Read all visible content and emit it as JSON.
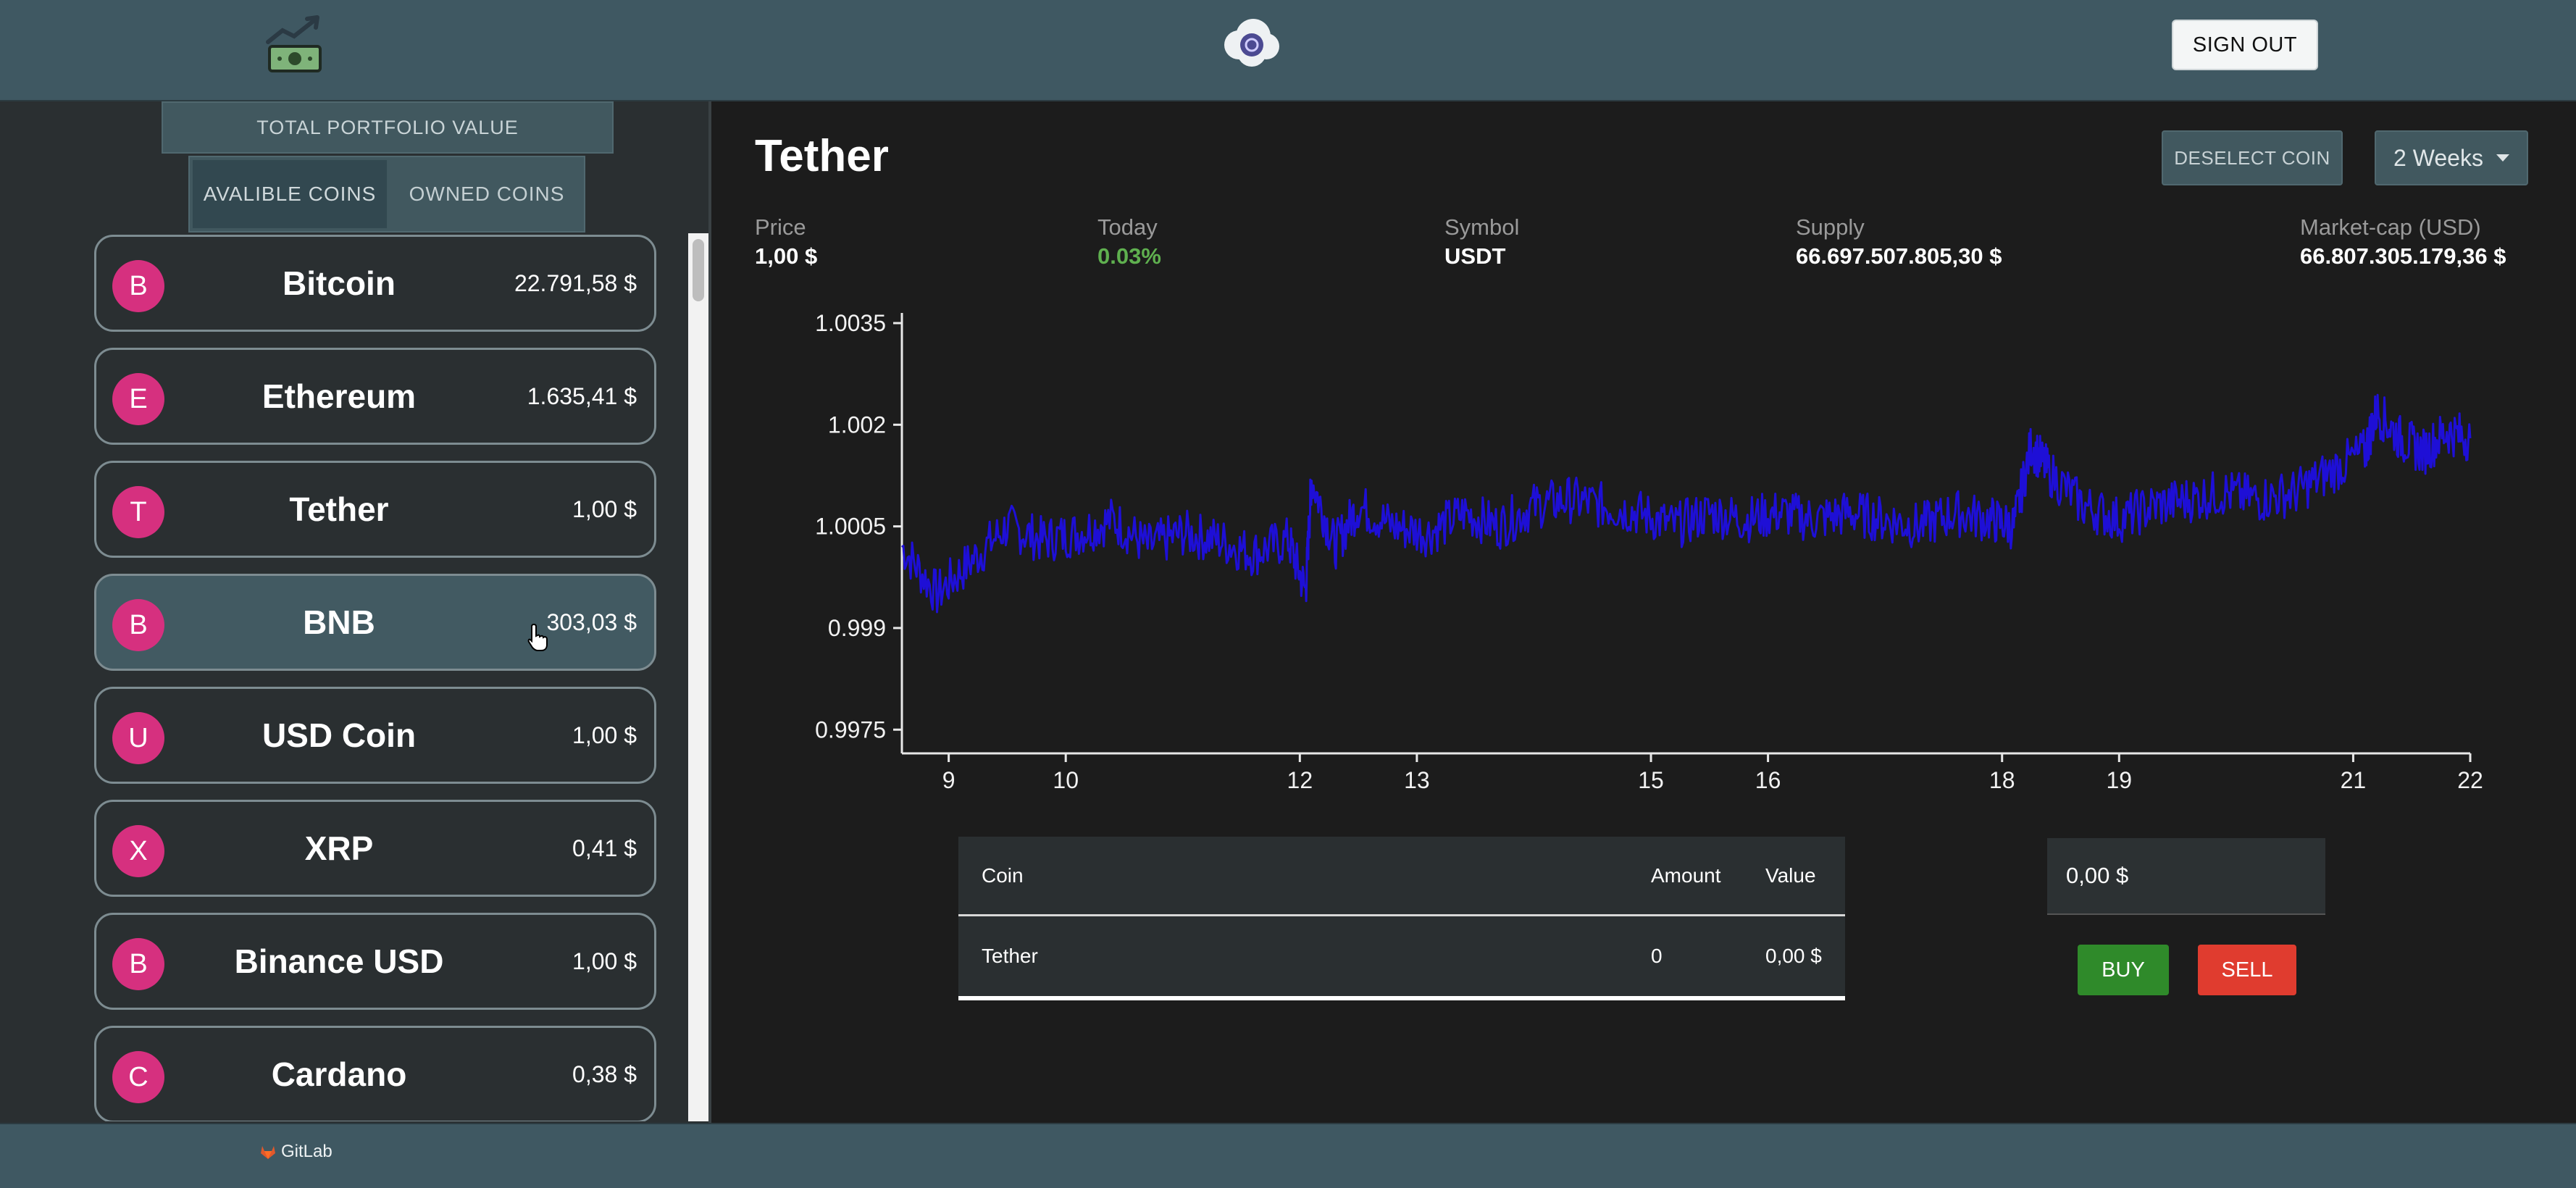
{
  "header": {
    "signout_label": "SIGN OUT"
  },
  "sidebar": {
    "portfolio_label": "TOTAL PORTFOLIO VALUE",
    "tabs": [
      {
        "label": "AVALIBLE COINS",
        "active": true
      },
      {
        "label": "OWNED COINS",
        "active": false
      }
    ],
    "coins": [
      {
        "avatar": "B",
        "name": "Bitcoin",
        "price": "22.791,58 $"
      },
      {
        "avatar": "E",
        "name": "Ethereum",
        "price": "1.635,41 $"
      },
      {
        "avatar": "T",
        "name": "Tether",
        "price": "1,00 $"
      },
      {
        "avatar": "B",
        "name": "BNB",
        "price": "303,03 $",
        "hovered": true
      },
      {
        "avatar": "U",
        "name": "USD Coin",
        "price": "1,00 $"
      },
      {
        "avatar": "X",
        "name": "XRP",
        "price": "0,41 $"
      },
      {
        "avatar": "B",
        "name": "Binance USD",
        "price": "1,00 $"
      },
      {
        "avatar": "C",
        "name": "Cardano",
        "price": "0,38 $"
      }
    ]
  },
  "main": {
    "title": "Tether",
    "deselect_label": "DESELECT COIN",
    "range_label": "2 Weeks",
    "stats": {
      "price_label": "Price",
      "price_value": "1,00 $",
      "today_label": "Today",
      "today_value": "0.03%",
      "symbol_label": "Symbol",
      "symbol_value": "USDT",
      "supply_label": "Supply",
      "supply_value": "66.697.507.805,30 $",
      "marketcap_label": "Market-cap (USD)",
      "marketcap_value": "66.807.305.179,36 $"
    }
  },
  "chart_data": {
    "type": "line",
    "title": "",
    "xlabel": "",
    "ylabel": "",
    "x_ticks": [
      "9",
      "10",
      "12",
      "13",
      "15",
      "16",
      "18",
      "19",
      "21",
      "22"
    ],
    "y_ticks": [
      "0.9975",
      "0.999",
      "1.0005",
      "1.002",
      "1.0035"
    ],
    "ylim": [
      0.99715,
      1.00365
    ],
    "xlim": [
      8.6,
      22
    ],
    "line_color": "#1e0fd6",
    "series": [
      {
        "points": [
          [
            8.6,
            1.0002
          ],
          [
            8.9,
            0.9995
          ],
          [
            9.2,
            1.0
          ],
          [
            9.5,
            1.0005
          ],
          [
            9.8,
            1.0003
          ],
          [
            10.1,
            1.0004
          ],
          [
            10.4,
            1.0006
          ],
          [
            10.7,
            1.0002
          ],
          [
            11.0,
            1.0004
          ],
          [
            11.3,
            1.0003
          ],
          [
            11.6,
            1.0001
          ],
          [
            11.9,
            1.0003
          ],
          [
            12.05,
            0.99955
          ],
          [
            12.1,
            1.0012
          ],
          [
            12.3,
            1.0002
          ],
          [
            12.5,
            1.0008
          ],
          [
            12.8,
            1.0005
          ],
          [
            13.1,
            1.0004
          ],
          [
            13.4,
            1.0007
          ],
          [
            13.7,
            1.0005
          ],
          [
            14.0,
            1.0008
          ],
          [
            14.3,
            1.0009
          ],
          [
            14.6,
            1.0008
          ],
          [
            14.9,
            1.0007
          ],
          [
            15.2,
            1.0005
          ],
          [
            15.5,
            1.0007
          ],
          [
            15.8,
            1.0006
          ],
          [
            16.1,
            1.0007
          ],
          [
            16.4,
            1.0006
          ],
          [
            16.7,
            1.0007
          ],
          [
            17.0,
            1.0006
          ],
          [
            17.3,
            1.0005
          ],
          [
            17.6,
            1.0007
          ],
          [
            17.9,
            1.0006
          ],
          [
            18.1,
            1.0005
          ],
          [
            18.25,
            1.0017
          ],
          [
            18.4,
            1.0013
          ],
          [
            18.7,
            1.0008
          ],
          [
            19.0,
            1.0006
          ],
          [
            19.3,
            1.0008
          ],
          [
            19.6,
            1.0009
          ],
          [
            19.9,
            1.001
          ],
          [
            20.2,
            1.0009
          ],
          [
            20.5,
            1.001
          ],
          [
            20.8,
            1.0013
          ],
          [
            21.1,
            1.0016
          ],
          [
            21.2,
            1.0022
          ],
          [
            21.4,
            1.0018
          ],
          [
            21.6,
            1.0016
          ],
          [
            21.8,
            1.0019
          ],
          [
            22.0,
            1.0018
          ]
        ]
      }
    ]
  },
  "holdings_table": {
    "headers": {
      "coin": "Coin",
      "amount": "Amount",
      "value": "Value"
    },
    "rows": [
      {
        "coin": "Tether",
        "amount": "0",
        "value": "0,00 $"
      }
    ]
  },
  "trade": {
    "amount_value": "0,00 $",
    "buy_label": "BUY",
    "sell_label": "SELL"
  },
  "footer": {
    "gitlab_label": "GitLab"
  }
}
